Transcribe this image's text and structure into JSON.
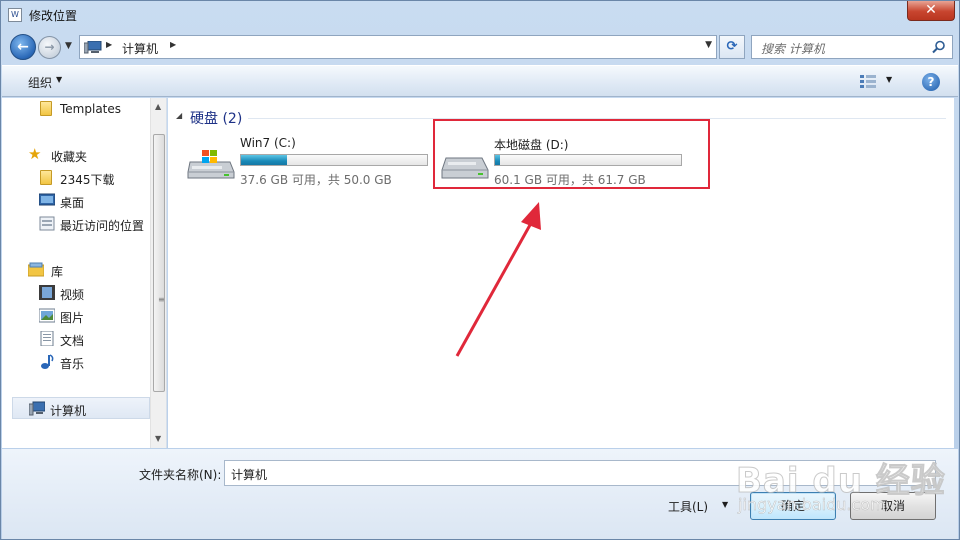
{
  "window": {
    "title": "修改位置",
    "close_label": "✕"
  },
  "nav": {
    "address_path": "计算机",
    "search_placeholder": "搜索 计算机"
  },
  "toolbar": {
    "organize_label": "组织",
    "help_label": "?"
  },
  "sidebar": {
    "items": [
      {
        "label": "Templates",
        "icon": "folder-icon"
      },
      {
        "label": "收藏夹",
        "icon": "star-icon"
      },
      {
        "label": "2345下载",
        "icon": "folder-icon"
      },
      {
        "label": "桌面",
        "icon": "desktop-icon"
      },
      {
        "label": "最近访问的位置",
        "icon": "recent-places-icon"
      },
      {
        "label": "库",
        "icon": "library-icon"
      },
      {
        "label": "视频",
        "icon": "video-icon"
      },
      {
        "label": "图片",
        "icon": "picture-icon"
      },
      {
        "label": "文档",
        "icon": "document-icon"
      },
      {
        "label": "音乐",
        "icon": "music-icon"
      },
      {
        "label": "计算机",
        "icon": "computer-icon",
        "selected": true
      }
    ]
  },
  "content": {
    "group_title": "硬盘 (2)",
    "drives": [
      {
        "name": "Win7 (C:)",
        "free_text": "37.6 GB 可用，共 50.0 GB",
        "used_fraction": 0.248,
        "icon": "windows-drive-icon"
      },
      {
        "name": "本地磁盘 (D:)",
        "free_text": "60.1 GB 可用，共 61.7 GB",
        "used_fraction": 0.026,
        "icon": "hard-drive-icon"
      }
    ]
  },
  "footer": {
    "folder_name_label": "文件夹名称(N):",
    "folder_name_value": "计算机",
    "tools_label": "工具(L)",
    "ok_label": "确定",
    "cancel_label": "取消"
  },
  "watermark": {
    "text": "Bai du 经验",
    "sub": "jingyan.baidu.com"
  },
  "colors": {
    "highlight": "#e0283a",
    "drive_fill": "#1a8ab8",
    "accent": "#1e3287"
  }
}
